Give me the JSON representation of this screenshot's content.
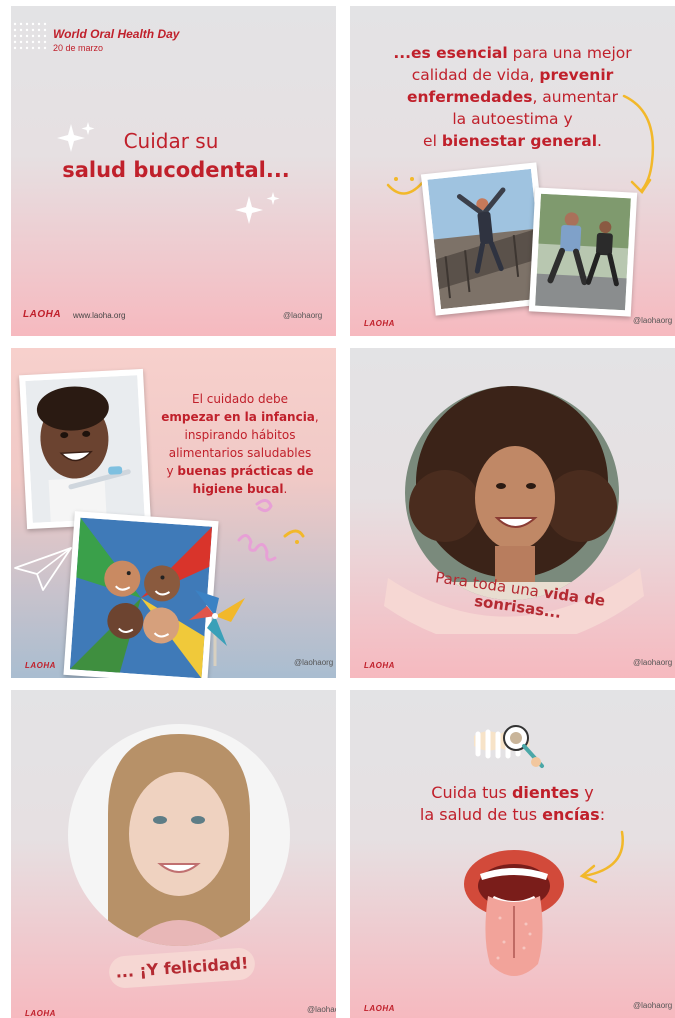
{
  "card1": {
    "event_title": "World Oral Health Day",
    "event_date": "20 de marzo",
    "line1": "Cuidar su",
    "line2": "salud bucodental...",
    "brand": "LAOHA",
    "website": "www.laoha.org",
    "handle": "@laohaorg"
  },
  "card2": {
    "l1_bold": "...es esencial",
    "l1_rest": " para una mejor",
    "l2_bold": "calidad de vida,",
    "l2_rest": " ",
    "l2_bold2": "prevenir",
    "l3_bold": "enfermedades",
    "l3_rest": ", aumentar",
    "l4": "la autoestima y",
    "l5_pre": "el ",
    "l5_bold": "bienestar general",
    "l5_post": ".",
    "brand": "LAOHA",
    "handle": "@laohaorg"
  },
  "card3": {
    "l1": "El cuidado debe",
    "l2_bold": "empezar en la infancia",
    "l2_post": ",",
    "l3": "inspirando hábitos",
    "l4": "alimentarios saludables",
    "l5_pre": "y ",
    "l5_bold": "buenas prácticas de",
    "l6_bold": "higiene bucal",
    "l6_post": ".",
    "brand": "LAOHA",
    "handle": "@laohaorg"
  },
  "card4": {
    "ribbon_pre": "Para toda una ",
    "ribbon_bold": "vida de sonrisas...",
    "brand": "LAOHA",
    "handle": "@laohaorg"
  },
  "card5": {
    "ribbon": "... ¡Y felicidad!",
    "brand": "LAOHA",
    "handle": "@laohao"
  },
  "card6": {
    "l1_pre": "Cuida tus ",
    "l1_bold": "dientes",
    "l1_post": " y",
    "l2_pre": "la salud de tus ",
    "l2_bold": "encías",
    "l2_post": ":",
    "brand": "LAOHA",
    "handle": "@laohaorg"
  },
  "colors": {
    "brand_red": "#c0202b",
    "accent_yellow": "#f2b82a"
  }
}
